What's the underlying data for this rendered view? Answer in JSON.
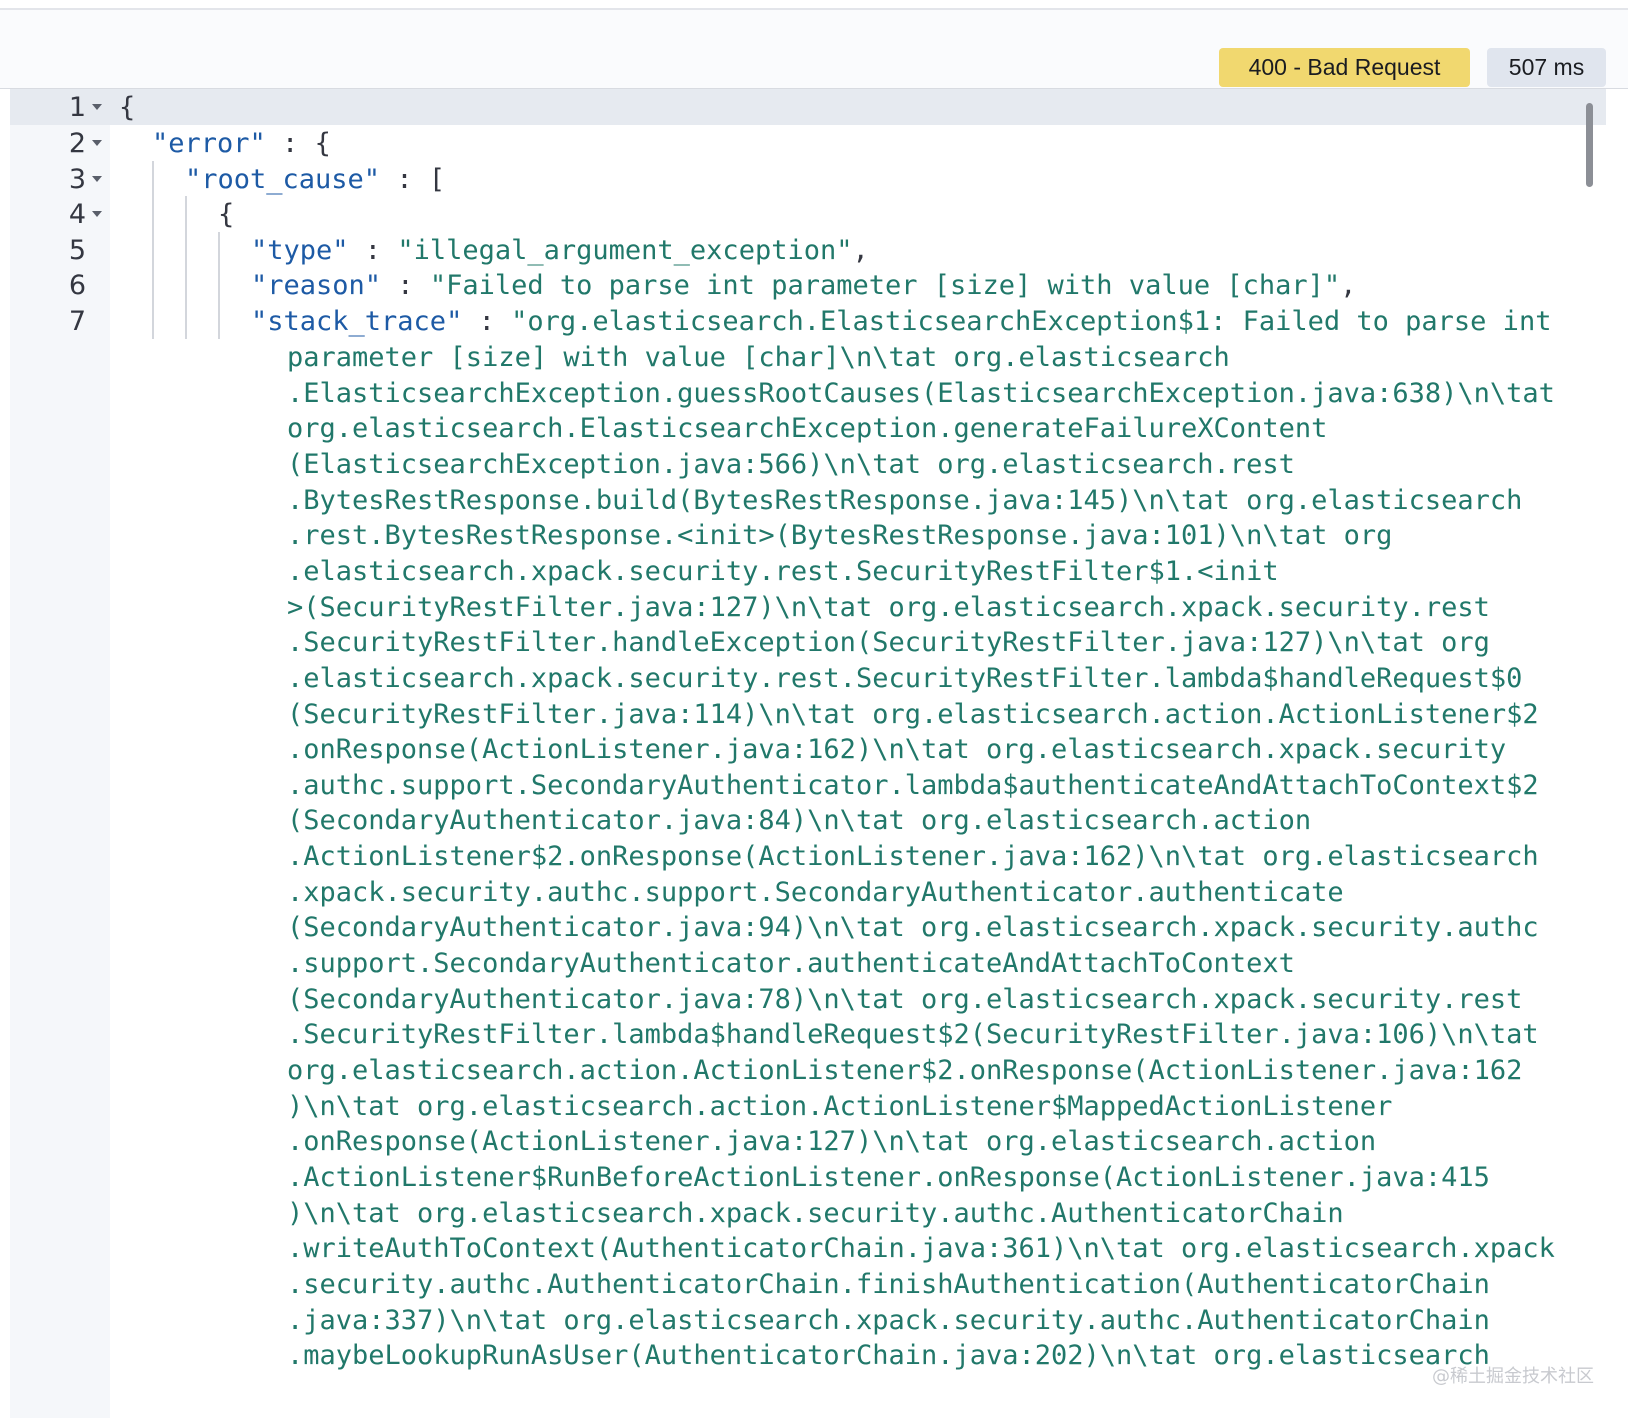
{
  "response": {
    "status": "400 - Bad Request",
    "time": "507 ms"
  },
  "lines": [
    {
      "num": "1",
      "fold": true
    },
    {
      "num": "2",
      "fold": true,
      "key": "\"error\"",
      "rest": " : {"
    },
    {
      "num": "3",
      "fold": true,
      "key": "\"root_cause\"",
      "rest": " : ["
    },
    {
      "num": "4",
      "fold": true
    },
    {
      "num": "5",
      "fold": false,
      "key": "\"type\"",
      "sep": " : ",
      "value": "\"illegal_argument_exception\"",
      "tail": ","
    },
    {
      "num": "6",
      "fold": false,
      "key": "\"reason\"",
      "sep": " : ",
      "value": "\"Failed to parse int parameter [size] with value [char]\"",
      "tail": ","
    },
    {
      "num": "7",
      "fold": false,
      "key": "\"stack_trace\"",
      "sep": " : ",
      "value": "\"org.elasticsearch.ElasticsearchException$1: Failed to parse int"
    }
  ],
  "line1_text": "{",
  "line4_text": "{",
  "stack_trace_wrapped": [
    "parameter [size] with value [char]\\n\\tat org.elasticsearch",
    ".ElasticsearchException.guessRootCauses(ElasticsearchException.java:638)\\n\\tat",
    "org.elasticsearch.ElasticsearchException.generateFailureXContent",
    "(ElasticsearchException.java:566)\\n\\tat org.elasticsearch.rest",
    ".BytesRestResponse.build(BytesRestResponse.java:145)\\n\\tat org.elasticsearch",
    ".rest.BytesRestResponse.<init>(BytesRestResponse.java:101)\\n\\tat org",
    ".elasticsearch.xpack.security.rest.SecurityRestFilter$1.<init",
    ">(SecurityRestFilter.java:127)\\n\\tat org.elasticsearch.xpack.security.rest",
    ".SecurityRestFilter.handleException(SecurityRestFilter.java:127)\\n\\tat org",
    ".elasticsearch.xpack.security.rest.SecurityRestFilter.lambda$handleRequest$0",
    "(SecurityRestFilter.java:114)\\n\\tat org.elasticsearch.action.ActionListener$2",
    ".onResponse(ActionListener.java:162)\\n\\tat org.elasticsearch.xpack.security",
    ".authc.support.SecondaryAuthenticator.lambda$authenticateAndAttachToContext$2",
    "(SecondaryAuthenticator.java:84)\\n\\tat org.elasticsearch.action",
    ".ActionListener$2.onResponse(ActionListener.java:162)\\n\\tat org.elasticsearch",
    ".xpack.security.authc.support.SecondaryAuthenticator.authenticate",
    "(SecondaryAuthenticator.java:94)\\n\\tat org.elasticsearch.xpack.security.authc",
    ".support.SecondaryAuthenticator.authenticateAndAttachToContext",
    "(SecondaryAuthenticator.java:78)\\n\\tat org.elasticsearch.xpack.security.rest",
    ".SecurityRestFilter.lambda$handleRequest$2(SecurityRestFilter.java:106)\\n\\tat",
    "org.elasticsearch.action.ActionListener$2.onResponse(ActionListener.java:162",
    ")\\n\\tat org.elasticsearch.action.ActionListener$MappedActionListener",
    ".onResponse(ActionListener.java:127)\\n\\tat org.elasticsearch.action",
    ".ActionListener$RunBeforeActionListener.onResponse(ActionListener.java:415",
    ")\\n\\tat org.elasticsearch.xpack.security.authc.AuthenticatorChain",
    ".writeAuthToContext(AuthenticatorChain.java:361)\\n\\tat org.elasticsearch.xpack",
    ".security.authc.AuthenticatorChain.finishAuthentication(AuthenticatorChain",
    ".java:337)\\n\\tat org.elasticsearch.xpack.security.authc.AuthenticatorChain",
    ".maybeLookupRunAsUser(AuthenticatorChain.java:202)\\n\\tat org.elasticsearch"
  ],
  "watermark": "@稀土掘金技术社区",
  "colors": {
    "status_badge": "#f1d86f",
    "time_badge": "#e0e5ee",
    "json_key": "#1d5aa5",
    "json_string": "#21786a"
  },
  "icons": {
    "fold": "caret-down-icon"
  }
}
